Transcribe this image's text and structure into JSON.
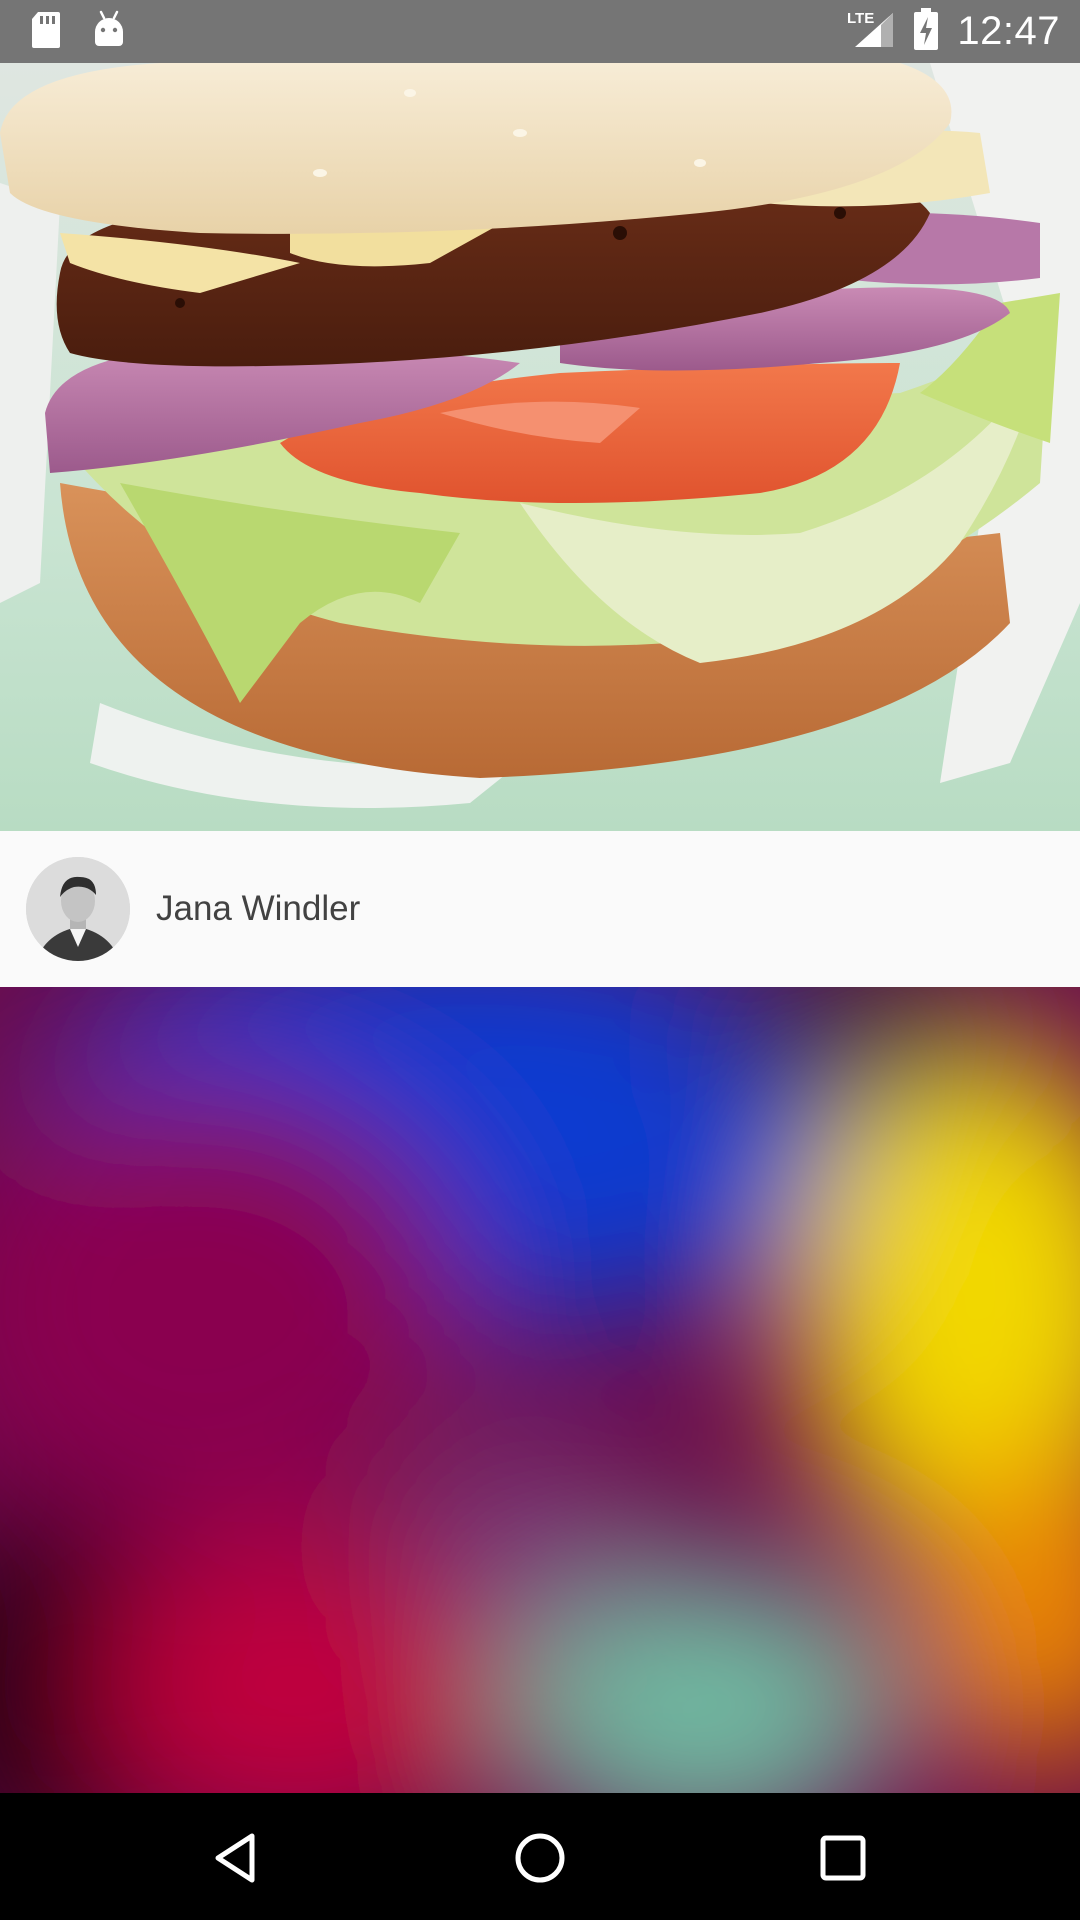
{
  "status_bar": {
    "network_label": "LTE",
    "time": "12:47",
    "icons": [
      "sd-card-icon",
      "android-icon",
      "signal-icon",
      "battery-charging-icon"
    ]
  },
  "feed": {
    "items": [
      {
        "image": "burger-photo",
        "author": "Jana Windler",
        "avatar": "avatar-photo"
      },
      {
        "image": "abstract-gradient-photo"
      }
    ]
  },
  "nav_bar": {
    "icons": [
      "back-icon",
      "home-icon",
      "recents-icon"
    ]
  },
  "colors": {
    "status_bar": "#757575",
    "author_row": "#fafafa",
    "author_text": "#424242",
    "nav_bar": "#000000"
  }
}
